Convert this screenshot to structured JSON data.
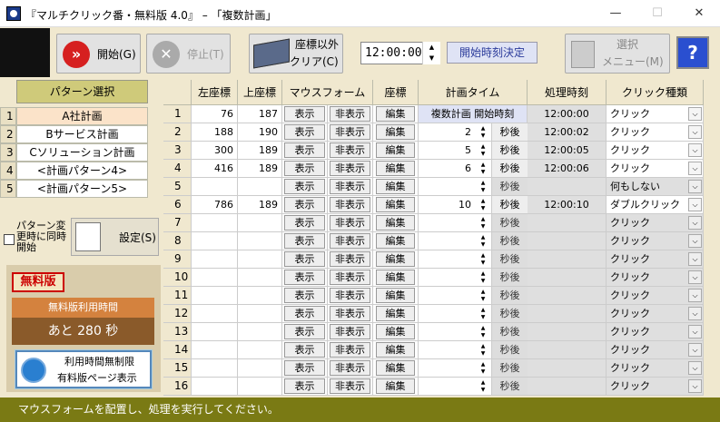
{
  "window": {
    "title": "『マルチクリック番・無料版 4.0』 – 「複数計画」",
    "minimize": "—",
    "maximize": "☐",
    "close": "✕"
  },
  "toolbar": {
    "start_label": "開始(G)",
    "stop_label": "停止(T)",
    "clear_label_1": "座標以外",
    "clear_label_2": "クリア(C)",
    "time_value": "12:00:00",
    "start_time_label": "開始時刻決定",
    "menu_label_1": "選択",
    "menu_label_2": "メニュー(M)",
    "help_label": "?"
  },
  "patterns": {
    "header": "パターン選択",
    "items": [
      {
        "num": "1",
        "name": "A社計画"
      },
      {
        "num": "2",
        "name": "Bサービス計画"
      },
      {
        "num": "3",
        "name": "Cソリューション計画"
      },
      {
        "num": "4",
        "name": "<計画パターン4>"
      },
      {
        "num": "5",
        "name": "<計画パターン5>"
      }
    ],
    "selected_index": 0
  },
  "options": {
    "change_label": "パターン変更時に同時開始",
    "settings_label": "設定(S)"
  },
  "free": {
    "badge": "無料版",
    "time_header": "無料版利用時間",
    "remaining": "あと 280 秒",
    "unlimited_l1": "利用時間無制限",
    "unlimited_l2": "有料版ページ表示"
  },
  "grid": {
    "headers": [
      "",
      "左座標",
      "上座標",
      "マウスフォーム",
      "座標",
      "計画タイム",
      "処理時刻",
      "クリック種類"
    ],
    "show_label": "表示",
    "hide_label": "非表示",
    "edit_label": "編集",
    "unit_label": "秒後",
    "first_plan_label": "複数計画 開始時刻",
    "rows": [
      {
        "num": "1",
        "x": "76",
        "y": "187",
        "plan": "",
        "proc": "12:00:00",
        "click": "クリック"
      },
      {
        "num": "2",
        "x": "188",
        "y": "190",
        "plan": "2",
        "proc": "12:00:02",
        "click": "クリック"
      },
      {
        "num": "3",
        "x": "300",
        "y": "189",
        "plan": "5",
        "proc": "12:00:05",
        "click": "クリック"
      },
      {
        "num": "4",
        "x": "416",
        "y": "189",
        "plan": "6",
        "proc": "12:00:06",
        "click": "クリック"
      },
      {
        "num": "5",
        "x": "",
        "y": "",
        "plan": "",
        "proc": "",
        "click": "何もしない"
      },
      {
        "num": "6",
        "x": "786",
        "y": "189",
        "plan": "10",
        "proc": "12:00:10",
        "click": "ダブルクリック"
      },
      {
        "num": "7",
        "x": "",
        "y": "",
        "plan": "",
        "proc": "",
        "click": "クリック"
      },
      {
        "num": "8",
        "x": "",
        "y": "",
        "plan": "",
        "proc": "",
        "click": "クリック"
      },
      {
        "num": "9",
        "x": "",
        "y": "",
        "plan": "",
        "proc": "",
        "click": "クリック"
      },
      {
        "num": "10",
        "x": "",
        "y": "",
        "plan": "",
        "proc": "",
        "click": "クリック"
      },
      {
        "num": "11",
        "x": "",
        "y": "",
        "plan": "",
        "proc": "",
        "click": "クリック"
      },
      {
        "num": "12",
        "x": "",
        "y": "",
        "plan": "",
        "proc": "",
        "click": "クリック"
      },
      {
        "num": "13",
        "x": "",
        "y": "",
        "plan": "",
        "proc": "",
        "click": "クリック"
      },
      {
        "num": "14",
        "x": "",
        "y": "",
        "plan": "",
        "proc": "",
        "click": "クリック"
      },
      {
        "num": "15",
        "x": "",
        "y": "",
        "plan": "",
        "proc": "",
        "click": "クリック"
      },
      {
        "num": "16",
        "x": "",
        "y": "",
        "plan": "",
        "proc": "",
        "click": "クリック"
      }
    ]
  },
  "status": {
    "text": "マウスフォームを配置し、処理を実行してください。"
  }
}
